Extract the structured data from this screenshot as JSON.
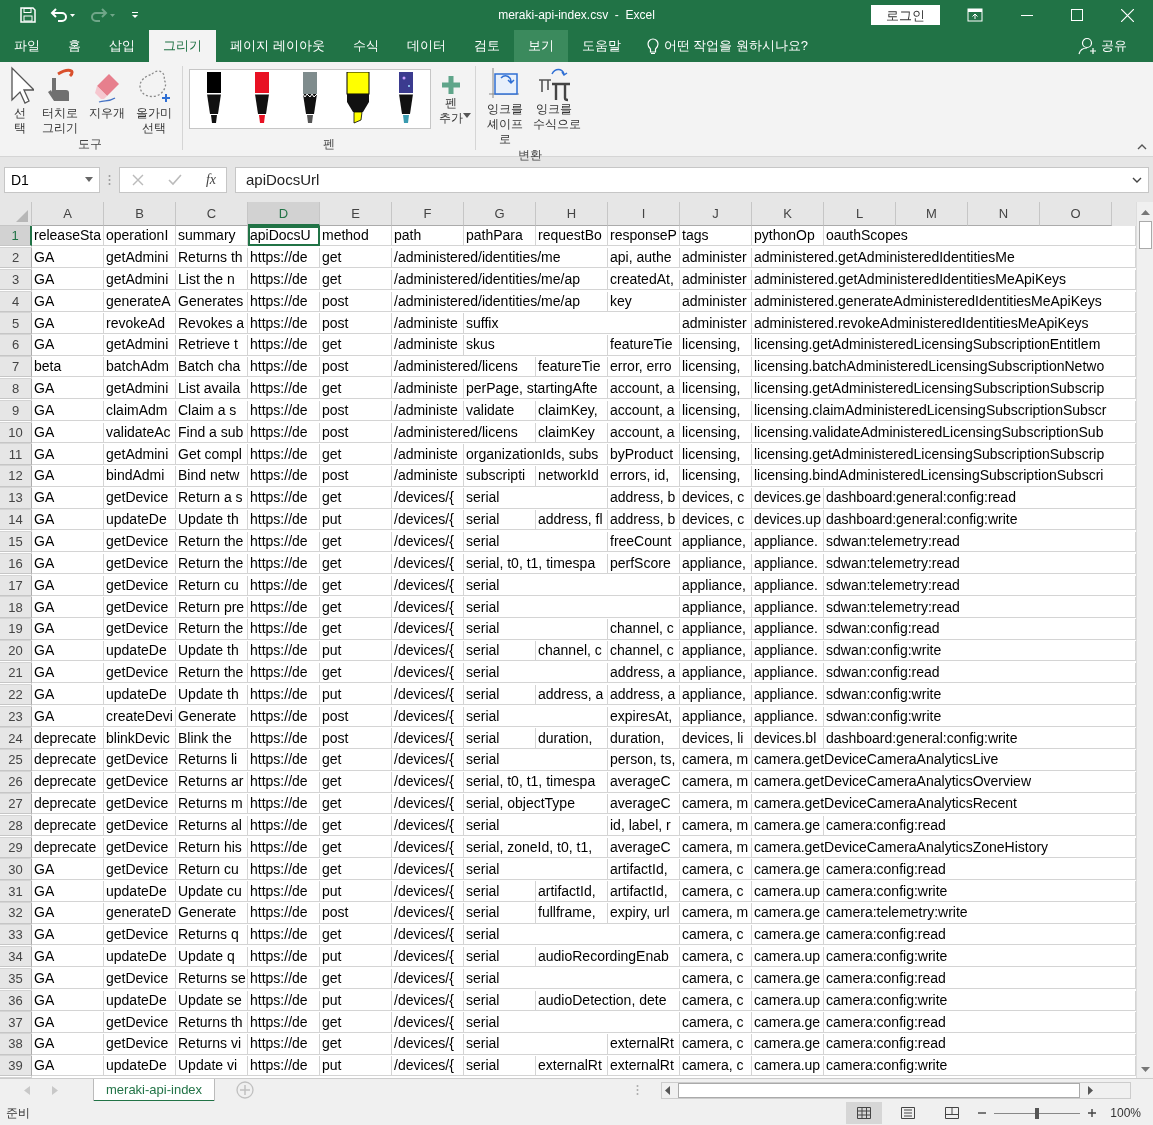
{
  "title_bar": {
    "title": "meraki-api-index.csv  -  Excel",
    "login": "로그인"
  },
  "ribbon_tabs": [
    {
      "label": "파일",
      "selected": false,
      "highlighted": false
    },
    {
      "label": "홈",
      "selected": false,
      "highlighted": false
    },
    {
      "label": "삽입",
      "selected": false,
      "highlighted": false
    },
    {
      "label": "그리기",
      "selected": true,
      "highlighted": false
    },
    {
      "label": "페이지 레이아웃",
      "selected": false,
      "highlighted": false
    },
    {
      "label": "수식",
      "selected": false,
      "highlighted": false
    },
    {
      "label": "데이터",
      "selected": false,
      "highlighted": false
    },
    {
      "label": "검토",
      "selected": false,
      "highlighted": false
    },
    {
      "label": "보기",
      "selected": false,
      "highlighted": true
    },
    {
      "label": "도움말",
      "selected": false,
      "highlighted": false
    }
  ],
  "tell_me": "어떤 작업을 원하시나요?",
  "share": "공유",
  "tools_group": {
    "label": "도구",
    "buttons": [
      {
        "kind": "select",
        "label": "선택"
      },
      {
        "kind": "touch",
        "label": "터치로 그리기"
      },
      {
        "kind": "eraser",
        "label": "지우개"
      },
      {
        "kind": "lasso",
        "label": "올가미 선택"
      }
    ]
  },
  "pens_group": {
    "label": "펜",
    "pens": [
      {
        "kind": "pen",
        "color": "#000000"
      },
      {
        "kind": "pen",
        "color": "#e81123"
      },
      {
        "kind": "pencil",
        "color": "#7f8c8d"
      },
      {
        "kind": "highlighter",
        "color": "#ffff00"
      },
      {
        "kind": "galaxy",
        "color": "#3b3b8f"
      }
    ],
    "add_label": "펜 추가"
  },
  "convert_group": {
    "label": "변환",
    "buttons": [
      {
        "kind": "shape",
        "label": "잉크를 셰이프로"
      },
      {
        "kind": "math",
        "label": "잉크를 수식으로"
      }
    ]
  },
  "formula_bar": {
    "name_box": "D1",
    "function_label": "fx",
    "formula": "apiDocsUrl"
  },
  "columns": [
    {
      "label": "A",
      "selected": false
    },
    {
      "label": "B",
      "selected": false
    },
    {
      "label": "C",
      "selected": false
    },
    {
      "label": "D",
      "selected": true
    },
    {
      "label": "E",
      "selected": false
    },
    {
      "label": "F",
      "selected": false
    },
    {
      "label": "G",
      "selected": false
    },
    {
      "label": "H",
      "selected": false
    },
    {
      "label": "I",
      "selected": false
    },
    {
      "label": "J",
      "selected": false
    },
    {
      "label": "K",
      "selected": false
    },
    {
      "label": "L",
      "selected": false
    },
    {
      "label": "M",
      "selected": false
    },
    {
      "label": "N",
      "selected": false
    },
    {
      "label": "O",
      "selected": false
    }
  ],
  "rows": [
    {
      "label": "1",
      "selected": true,
      "cells": [
        "releaseSta",
        "operationI",
        "summary",
        "apiDocsU",
        "method",
        "path",
        "pathPara",
        "requestBo",
        "responseP",
        "tags",
        "pythonOp",
        "oauthScopes"
      ]
    },
    {
      "label": "2",
      "selected": false,
      "cells": [
        "GA",
        "getAdmini",
        "Returns th",
        "https://de",
        "get",
        "/administered/identities/me",
        null,
        null,
        "api, authe",
        "administer",
        "administered.getAdministeredIdentitiesMe"
      ]
    },
    {
      "label": "3",
      "selected": false,
      "cells": [
        "GA",
        "getAdmini",
        "List the n",
        "https://de",
        "get",
        "/administered/identities/me/ap",
        null,
        null,
        "createdAt,",
        "administer",
        "administered.getAdministeredIdentitiesMeApiKeys"
      ]
    },
    {
      "label": "4",
      "selected": false,
      "cells": [
        "GA",
        "generateA",
        "Generates",
        "https://de",
        "post",
        "/administered/identities/me/ap",
        null,
        null,
        "key",
        "administer",
        "administered.generateAdministeredIdentitiesMeApiKeys"
      ]
    },
    {
      "label": "5",
      "selected": false,
      "cells": [
        "GA",
        "revokeAd",
        "Revokes a",
        "https://de",
        "post",
        "/administe",
        "suffix",
        null,
        null,
        "administer",
        "administered.revokeAdministeredIdentitiesMeApiKeys"
      ]
    },
    {
      "label": "6",
      "selected": false,
      "cells": [
        "GA",
        "getAdmini",
        "Retrieve t",
        "https://de",
        "get",
        "/administe",
        "skus",
        null,
        "featureTie",
        "licensing,",
        "licensing.getAdministeredLicensingSubscriptionEntitlem"
      ]
    },
    {
      "label": "7",
      "selected": false,
      "cells": [
        "beta",
        "batchAdm",
        "Batch cha",
        "https://de",
        "post",
        "/administered/licens",
        null,
        "featureTie",
        "error, erro",
        "licensing,",
        "licensing.batchAdministeredLicensingSubscriptionNetwo"
      ]
    },
    {
      "label": "8",
      "selected": false,
      "cells": [
        "GA",
        "getAdmini",
        "List availa",
        "https://de",
        "get",
        "/administe",
        "perPage, startingAfte",
        null,
        "account, a",
        "licensing,",
        "licensing.getAdministeredLicensingSubscriptionSubscrip"
      ]
    },
    {
      "label": "9",
      "selected": false,
      "cells": [
        "GA",
        "claimAdm",
        "Claim a s",
        "https://de",
        "post",
        "/administe",
        "validate",
        "claimKey,",
        "account, a",
        "licensing,",
        "licensing.claimAdministeredLicensingSubscriptionSubscr"
      ]
    },
    {
      "label": "10",
      "selected": false,
      "cells": [
        "GA",
        "validateAc",
        "Find a sub",
        "https://de",
        "post",
        "/administered/licens",
        null,
        "claimKey",
        "account, a",
        "licensing,",
        "licensing.validateAdministeredLicensingSubscriptionSub"
      ]
    },
    {
      "label": "11",
      "selected": false,
      "cells": [
        "GA",
        "getAdmini",
        "Get compl",
        "https://de",
        "get",
        "/administe",
        "organizationIds, subs",
        null,
        "byProduct",
        "licensing,",
        "licensing.getAdministeredLicensingSubscriptionSubscrip"
      ]
    },
    {
      "label": "12",
      "selected": false,
      "cells": [
        "GA",
        "bindAdmi",
        "Bind netw",
        "https://de",
        "post",
        "/administe",
        "subscripti",
        "networkId",
        "errors, id,",
        "licensing,",
        "licensing.bindAdministeredLicensingSubscriptionSubscri"
      ]
    },
    {
      "label": "13",
      "selected": false,
      "cells": [
        "GA",
        "getDevice",
        "Return a s",
        "https://de",
        "get",
        "/devices/{",
        "serial",
        null,
        "address, b",
        "devices, c",
        "devices.ge",
        "dashboard:general:config:read"
      ]
    },
    {
      "label": "14",
      "selected": false,
      "cells": [
        "GA",
        "updateDe",
        "Update th",
        "https://de",
        "put",
        "/devices/{",
        "serial",
        "address, fl",
        "address, b",
        "devices, c",
        "devices.up",
        "dashboard:general:config:write"
      ]
    },
    {
      "label": "15",
      "selected": false,
      "cells": [
        "GA",
        "getDevice",
        "Return the",
        "https://de",
        "get",
        "/devices/{",
        "serial",
        null,
        "freeCount",
        "appliance,",
        "appliance.",
        "sdwan:telemetry:read"
      ]
    },
    {
      "label": "16",
      "selected": false,
      "cells": [
        "GA",
        "getDevice",
        "Return the",
        "https://de",
        "get",
        "/devices/{",
        "serial, t0, t1, timespa",
        null,
        "perfScore",
        "appliance,",
        "appliance.",
        "sdwan:telemetry:read"
      ]
    },
    {
      "label": "17",
      "selected": false,
      "cells": [
        "GA",
        "getDevice",
        "Return cu",
        "https://de",
        "get",
        "/devices/{",
        "serial",
        null,
        null,
        "appliance,",
        "appliance.",
        "sdwan:telemetry:read"
      ]
    },
    {
      "label": "18",
      "selected": false,
      "cells": [
        "GA",
        "getDevice",
        "Return pre",
        "https://de",
        "get",
        "/devices/{",
        "serial",
        null,
        null,
        "appliance,",
        "appliance.",
        "sdwan:telemetry:read"
      ]
    },
    {
      "label": "19",
      "selected": false,
      "cells": [
        "GA",
        "getDevice",
        "Return the",
        "https://de",
        "get",
        "/devices/{",
        "serial",
        null,
        "channel, c",
        "appliance,",
        "appliance.",
        "sdwan:config:read"
      ]
    },
    {
      "label": "20",
      "selected": false,
      "cells": [
        "GA",
        "updateDe",
        "Update th",
        "https://de",
        "put",
        "/devices/{",
        "serial",
        "channel, c",
        "channel, c",
        "appliance,",
        "appliance.",
        "sdwan:config:write"
      ]
    },
    {
      "label": "21",
      "selected": false,
      "cells": [
        "GA",
        "getDevice",
        "Return the",
        "https://de",
        "get",
        "/devices/{",
        "serial",
        null,
        "address, a",
        "appliance,",
        "appliance.",
        "sdwan:config:read"
      ]
    },
    {
      "label": "22",
      "selected": false,
      "cells": [
        "GA",
        "updateDe",
        "Update th",
        "https://de",
        "put",
        "/devices/{",
        "serial",
        "address, a",
        "address, a",
        "appliance,",
        "appliance.",
        "sdwan:config:write"
      ]
    },
    {
      "label": "23",
      "selected": false,
      "cells": [
        "GA",
        "createDevi",
        "Generate",
        "https://de",
        "post",
        "/devices/{",
        "serial",
        null,
        "expiresAt,",
        "appliance,",
        "appliance.",
        "sdwan:config:write"
      ]
    },
    {
      "label": "24",
      "selected": false,
      "cells": [
        "deprecate",
        "blinkDevic",
        "Blink the",
        "https://de",
        "post",
        "/devices/{",
        "serial",
        "duration,",
        "duration,",
        "devices, li",
        "devices.bl",
        "dashboard:general:config:write"
      ]
    },
    {
      "label": "25",
      "selected": false,
      "cells": [
        "deprecate",
        "getDevice",
        "Returns li",
        "https://de",
        "get",
        "/devices/{",
        "serial",
        null,
        "person, ts,",
        "camera, m",
        "camera.getDeviceCameraAnalyticsLive"
      ]
    },
    {
      "label": "26",
      "selected": false,
      "cells": [
        "deprecate",
        "getDevice",
        "Returns ar",
        "https://de",
        "get",
        "/devices/{",
        "serial, t0, t1, timespa",
        null,
        "averageC",
        "camera, m",
        "camera.getDeviceCameraAnalyticsOverview"
      ]
    },
    {
      "label": "27",
      "selected": false,
      "cells": [
        "deprecate",
        "getDevice",
        "Returns m",
        "https://de",
        "get",
        "/devices/{",
        "serial, objectType",
        null,
        "averageC",
        "camera, m",
        "camera.getDeviceCameraAnalyticsRecent"
      ]
    },
    {
      "label": "28",
      "selected": false,
      "cells": [
        "deprecate",
        "getDevice",
        "Returns al",
        "https://de",
        "get",
        "/devices/{",
        "serial",
        null,
        "id, label, r",
        "camera, m",
        "camera.ge",
        "camera:config:read"
      ]
    },
    {
      "label": "29",
      "selected": false,
      "cells": [
        "deprecate",
        "getDevice",
        "Return his",
        "https://de",
        "get",
        "/devices/{",
        "serial, zoneId, t0, t1,",
        null,
        "averageC",
        "camera, m",
        "camera.getDeviceCameraAnalyticsZoneHistory"
      ]
    },
    {
      "label": "30",
      "selected": false,
      "cells": [
        "GA",
        "getDevice",
        "Return cu",
        "https://de",
        "get",
        "/devices/{",
        "serial",
        null,
        "artifactId,",
        "camera, c",
        "camera.ge",
        "camera:config:read"
      ]
    },
    {
      "label": "31",
      "selected": false,
      "cells": [
        "GA",
        "updateDe",
        "Update cu",
        "https://de",
        "put",
        "/devices/{",
        "serial",
        "artifactId,",
        "artifactId,",
        "camera, c",
        "camera.up",
        "camera:config:write"
      ]
    },
    {
      "label": "32",
      "selected": false,
      "cells": [
        "GA",
        "generateD",
        "Generate",
        "https://de",
        "post",
        "/devices/{",
        "serial",
        "fullframe,",
        "expiry, url",
        "camera, m",
        "camera.ge",
        "camera:telemetry:write"
      ]
    },
    {
      "label": "33",
      "selected": false,
      "cells": [
        "GA",
        "getDevice",
        "Returns q",
        "https://de",
        "get",
        "/devices/{",
        "serial",
        null,
        null,
        "camera, c",
        "camera.ge",
        "camera:config:read"
      ]
    },
    {
      "label": "34",
      "selected": false,
      "cells": [
        "GA",
        "updateDe",
        "Update q",
        "https://de",
        "put",
        "/devices/{",
        "serial",
        "audioRecordingEnab",
        null,
        "camera, c",
        "camera.up",
        "camera:config:write"
      ]
    },
    {
      "label": "35",
      "selected": false,
      "cells": [
        "GA",
        "getDevice",
        "Returns se",
        "https://de",
        "get",
        "/devices/{",
        "serial",
        null,
        null,
        "camera, c",
        "camera.ge",
        "camera:config:read"
      ]
    },
    {
      "label": "36",
      "selected": false,
      "cells": [
        "GA",
        "updateDe",
        "Update se",
        "https://de",
        "put",
        "/devices/{",
        "serial",
        "audioDetection, dete",
        null,
        "camera, c",
        "camera.up",
        "camera:config:write"
      ]
    },
    {
      "label": "37",
      "selected": false,
      "cells": [
        "GA",
        "getDevice",
        "Returns th",
        "https://de",
        "get",
        "/devices/{",
        "serial",
        null,
        null,
        "camera, c",
        "camera.ge",
        "camera:config:read"
      ]
    },
    {
      "label": "38",
      "selected": false,
      "cells": [
        "GA",
        "getDevice",
        "Returns vi",
        "https://de",
        "get",
        "/devices/{",
        "serial",
        null,
        "externalRt",
        "camera, c",
        "camera.ge",
        "camera:config:read"
      ]
    },
    {
      "label": "39",
      "selected": false,
      "cells": [
        "GA",
        "updateDe",
        "Update vi",
        "https://de",
        "put",
        "/devices/{",
        "serial",
        "externalRt",
        "externalRt",
        "camera, c",
        "camera.up",
        "camera:config:write"
      ]
    }
  ],
  "sheets": [
    {
      "name": "meraki-api-index",
      "selected": true
    }
  ],
  "status_bar": {
    "text": "준비",
    "views": [
      {
        "kind": "normal",
        "selected": true
      },
      {
        "kind": "page_layout",
        "selected": false
      },
      {
        "kind": "page_break",
        "selected": false
      }
    ],
    "zoom_slider": {
      "level": 0.5
    },
    "zoom": "100%"
  }
}
